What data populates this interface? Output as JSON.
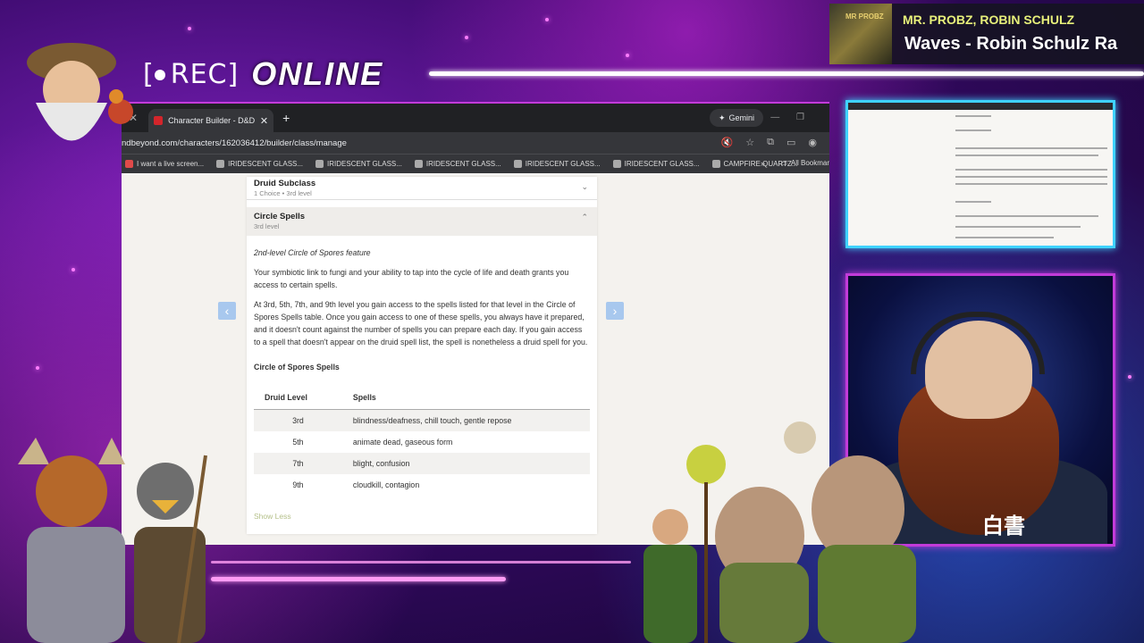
{
  "overlay": {
    "rec_label": "REC",
    "status": "ONLINE",
    "now_playing_artist": "MR. PROBZ, ROBIN SCHULZ",
    "now_playing_title": "Waves - Robin Schulz Ra",
    "album_art_text": "MR PROBZ"
  },
  "browser": {
    "tab_title": "Character Builder - D&D Beyond",
    "gemini_label": "Gemini",
    "url": "ndbeyond.com/characters/162036412/builder/class/manage",
    "bookmarks": [
      "I want a live screen...",
      "IRIDESCENT GLASS...",
      "IRIDESCENT GLASS...",
      "IRIDESCENT GLASS...",
      "IRIDESCENT GLASS...",
      "IRIDESCENT GLASS...",
      "CAMPFIRE QUARTZ..."
    ],
    "bookmarks_more": "»",
    "all_bookmarks": "All Bookmar"
  },
  "page": {
    "subclass_title": "Druid Subclass",
    "subclass_sub": "1 Choice • 3rd level",
    "spells_title": "Circle Spells",
    "spells_sub": "3rd level",
    "feature_line": "2nd-level Circle of Spores feature",
    "para1": "Your symbiotic link to fungi and your ability to tap into the cycle of life and death grants you access to certain spells.",
    "para2": "At 3rd, 5th, 7th, and 9th level you gain access to the spells listed for that level in the Circle of Spores Spells table. Once you gain access to one of these spells, you always have it prepared, and it doesn't count against the number of spells you can prepare each day. If you gain access to a spell that doesn't appear on the druid spell list, the spell is nonetheless a druid spell for you.",
    "table_title": "Circle of Spores Spells",
    "table_headers": [
      "Druid Level",
      "Spells"
    ],
    "table_rows": [
      {
        "level": "3rd",
        "spells": "blindness/deafness, chill touch, gentle repose"
      },
      {
        "level": "5th",
        "spells": "animate dead, gaseous form"
      },
      {
        "level": "7th",
        "spells": "blight, confusion"
      },
      {
        "level": "9th",
        "spells": "cloudkill, contagion"
      }
    ],
    "show_less": "Show Less"
  },
  "webcam": {
    "shirt_text": "白書"
  },
  "colors": {
    "accent_cyan": "#3fd3ff",
    "accent_magenta": "#c23bd9",
    "artist_yellow": "#e7f07a"
  }
}
